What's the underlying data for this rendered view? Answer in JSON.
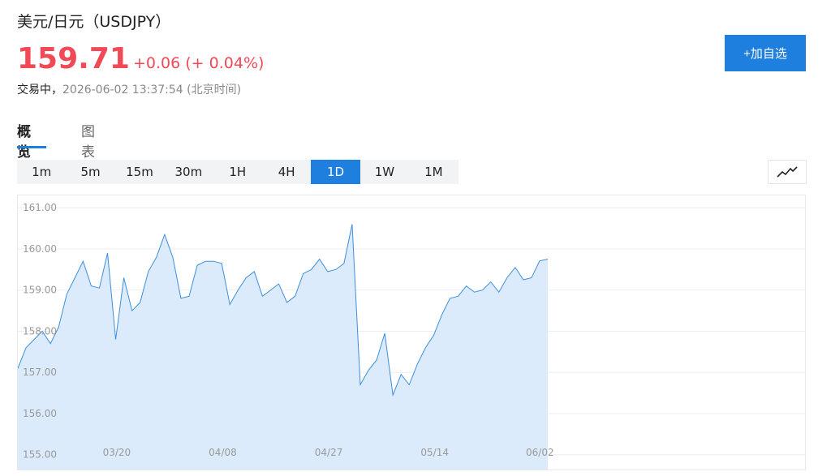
{
  "header": {
    "title": "美元/日元（USDJPY）",
    "price": "159.71",
    "change": "+0.06 (+ 0.04%)",
    "status_label": "交易中，",
    "timestamp": "2026-06-02 13:37:54 (北京时间)",
    "add_button": "+加自选"
  },
  "tabs": [
    {
      "label": "概览",
      "active": true
    },
    {
      "label": "图表",
      "active": false
    }
  ],
  "ranges": [
    {
      "label": "1m"
    },
    {
      "label": "5m"
    },
    {
      "label": "15m"
    },
    {
      "label": "30m"
    },
    {
      "label": "1H"
    },
    {
      "label": "4H"
    },
    {
      "label": "1D",
      "active": true
    },
    {
      "label": "1W"
    },
    {
      "label": "1M"
    }
  ],
  "chart_type_icon": "line-chart-icon",
  "colors": {
    "accent": "#1f7fde",
    "up": "#f24957",
    "line": "#3d8fdc",
    "area": "#dcebfb"
  },
  "chart_data": {
    "type": "area",
    "title": "",
    "xlabel": "",
    "ylabel": "",
    "ylim": [
      154.6,
      161.3
    ],
    "yticks": [
      155.0,
      156.0,
      157.0,
      158.0,
      159.0,
      160.0,
      161.0
    ],
    "ytick_labels": [
      "155.00",
      "156.00",
      "157.00",
      "158.00",
      "159.00",
      "160.00",
      "161.00"
    ],
    "xtick_labels": [
      {
        "label": "03/20",
        "index": 12
      },
      {
        "label": "04/08",
        "index": 25
      },
      {
        "label": "04/27",
        "index": 38
      },
      {
        "label": "05/14",
        "index": 51
      },
      {
        "label": "06/02",
        "index": 64
      }
    ],
    "total_points": 65,
    "grid": true,
    "series": [
      {
        "values": [
          157.1,
          157.6,
          157.8,
          158.0,
          157.7,
          158.1,
          158.9,
          159.3,
          159.7,
          159.1,
          159.05,
          159.9,
          157.8,
          159.3,
          158.5,
          158.7,
          159.45,
          159.8,
          160.35,
          159.8,
          158.8,
          158.85,
          159.6,
          159.7,
          159.7,
          159.65,
          158.65,
          159.0,
          159.3,
          159.45,
          158.85,
          159.0,
          159.15,
          158.7,
          158.85,
          159.4,
          159.5,
          159.75,
          159.45,
          159.5,
          159.65,
          160.6,
          156.7,
          157.05,
          157.3,
          157.95,
          156.45,
          156.95,
          156.7,
          157.2,
          157.6,
          157.9,
          158.4,
          158.8,
          158.85,
          159.1,
          158.95,
          159.0,
          159.2,
          158.95,
          159.3,
          159.55,
          159.25,
          159.3,
          159.71,
          159.75
        ]
      }
    ]
  }
}
